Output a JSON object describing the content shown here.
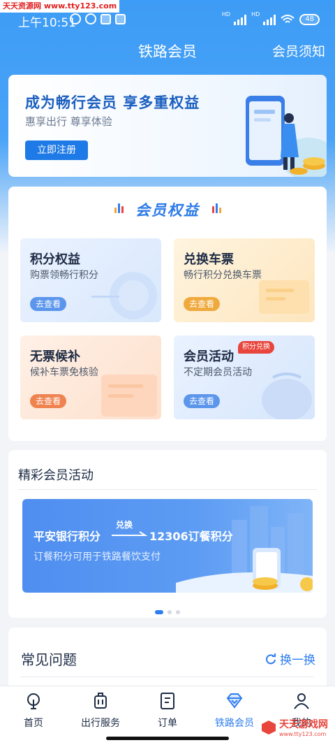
{
  "watermark": "天天资源网 www.tty123.com",
  "status": {
    "time": "上午10:51",
    "battery": "48"
  },
  "header": {
    "title": "铁路会员",
    "link": "会员须知"
  },
  "banner": {
    "title": "成为畅行会员 享多重权益",
    "subtitle": "惠享出行 尊享体验",
    "button": "立即注册"
  },
  "rights": {
    "title": "会员权益",
    "tiles": [
      {
        "title": "积分权益",
        "subtitle": "购票领畅行积分",
        "button": "去查看",
        "color": "#4f8ef0"
      },
      {
        "title": "兑换车票",
        "subtitle": "畅行积分兑换车票",
        "button": "去查看",
        "color": "#f2a530"
      },
      {
        "title": "无票候补",
        "subtitle": "候补车票免核验",
        "button": "去查看",
        "color": "#f0804a"
      },
      {
        "title": "会员活动",
        "subtitle": "不定期会员活动",
        "button": "去查看",
        "badge": "积分兑换",
        "color": "#4f8ef0"
      }
    ]
  },
  "activities": {
    "title": "精彩会员活动",
    "banner": {
      "from": "平安银行积分",
      "arrow": "兑换",
      "to": "12306订餐积分",
      "subtitle": "订餐积分可用于铁路餐饮支付"
    }
  },
  "faq": {
    "title": "常见问题",
    "refresh": "换一换"
  },
  "tabs": [
    {
      "label": "首页",
      "icon": "home-icon"
    },
    {
      "label": "出行服务",
      "icon": "luggage-icon"
    },
    {
      "label": "订单",
      "icon": "order-icon"
    },
    {
      "label": "铁路会员",
      "icon": "diamond-icon",
      "active": true
    },
    {
      "label": "我的",
      "icon": "user-icon"
    }
  ],
  "bottom_watermark": {
    "name": "天天游戏网",
    "url": "www.tty123.com"
  },
  "colors": {
    "primary": "#2e7df0",
    "header": "#3d9cf5",
    "badge": "#e8453c"
  }
}
